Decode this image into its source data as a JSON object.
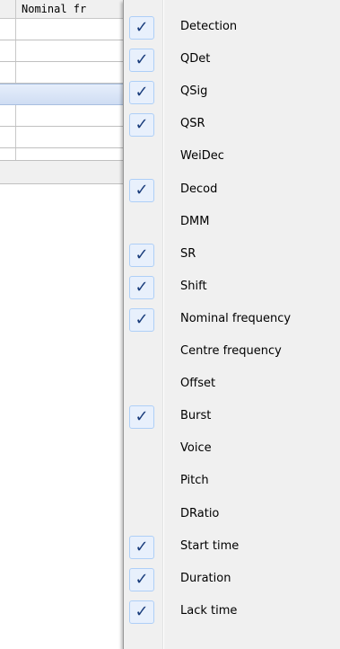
{
  "table": {
    "column_header": "Nominal fr"
  },
  "menu": {
    "items": [
      {
        "label": "Detection",
        "checked": true
      },
      {
        "label": "QDet",
        "checked": true
      },
      {
        "label": "QSig",
        "checked": true
      },
      {
        "label": "QSR",
        "checked": true
      },
      {
        "label": "WeiDec",
        "checked": false
      },
      {
        "label": "Decod",
        "checked": true
      },
      {
        "label": "DMM",
        "checked": false
      },
      {
        "label": "SR",
        "checked": true
      },
      {
        "label": "Shift",
        "checked": true
      },
      {
        "label": "Nominal frequency",
        "checked": true
      },
      {
        "label": "Centre frequency",
        "checked": false
      },
      {
        "label": "Offset",
        "checked": false
      },
      {
        "label": "Burst",
        "checked": true
      },
      {
        "label": "Voice",
        "checked": false
      },
      {
        "label": "Pitch",
        "checked": false
      },
      {
        "label": "DRatio",
        "checked": false
      },
      {
        "label": "Start time",
        "checked": true
      },
      {
        "label": "Duration",
        "checked": true
      },
      {
        "label": "Lack time",
        "checked": true
      }
    ],
    "check_glyph": "✓"
  },
  "colors": {
    "menu_background": "#f0f0f0",
    "check_box_background": "#e8f0fc",
    "check_box_border": "#aecff7",
    "check_color": "#1a3d7c",
    "selected_row": "#cfddf3"
  }
}
